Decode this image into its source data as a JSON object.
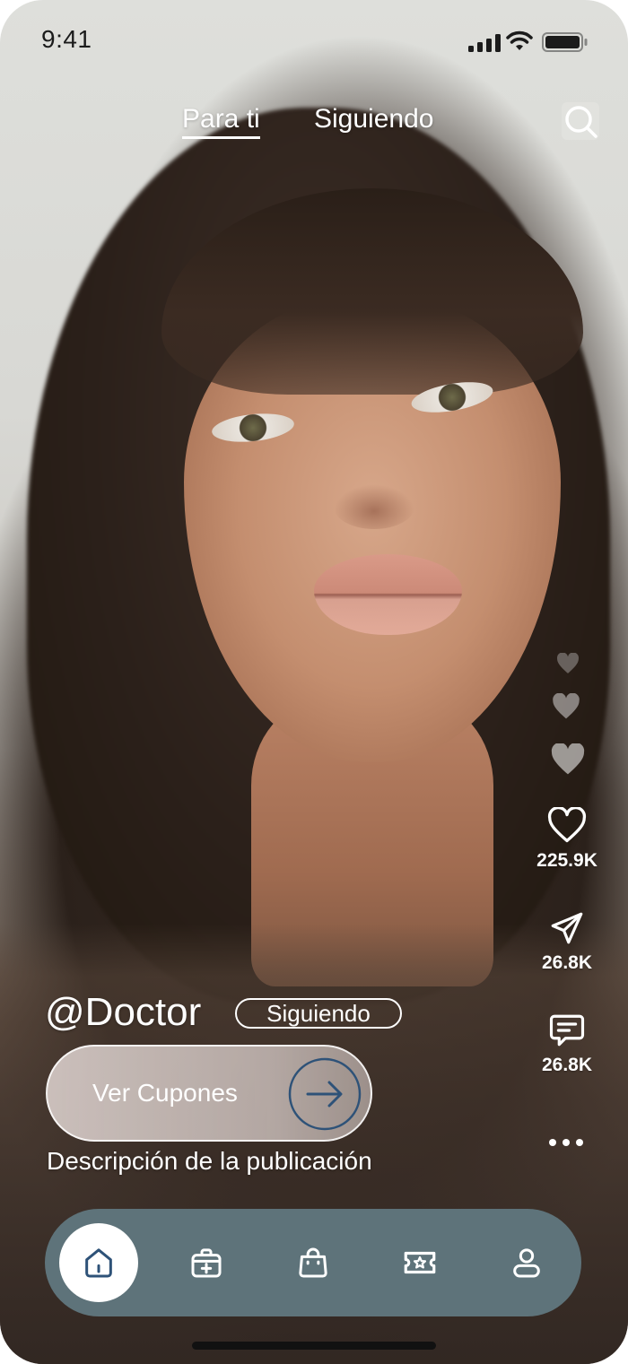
{
  "status_bar": {
    "time": "9:41",
    "icons": [
      "signal-icon",
      "wifi-icon",
      "battery-icon"
    ]
  },
  "top_tabs": {
    "items": [
      {
        "label": "Para ti",
        "active": true
      },
      {
        "label": "Siguiendo",
        "active": false
      }
    ],
    "search_icon": "search-icon"
  },
  "actions": {
    "likes": "225.9K",
    "shares": "26.8K",
    "comments": "26.8K",
    "icons": [
      "heart-icon",
      "send-icon",
      "comment-icon",
      "more-icon"
    ]
  },
  "post": {
    "handle": "@Doctor",
    "follow_label": "Siguiendo",
    "cta_label": "Ver Cupones",
    "description": "Descripción de la publicación"
  },
  "bottom_nav": {
    "items": [
      {
        "icon": "home-icon",
        "active": true
      },
      {
        "icon": "medical-kit-icon",
        "active": false
      },
      {
        "icon": "shopping-bag-icon",
        "active": false
      },
      {
        "icon": "ticket-icon",
        "active": false
      },
      {
        "icon": "profile-icon",
        "active": false
      }
    ]
  },
  "colors": {
    "nav_background": "#5e737a",
    "accent_dark": "#2e5278",
    "text_light": "#ffffff"
  }
}
